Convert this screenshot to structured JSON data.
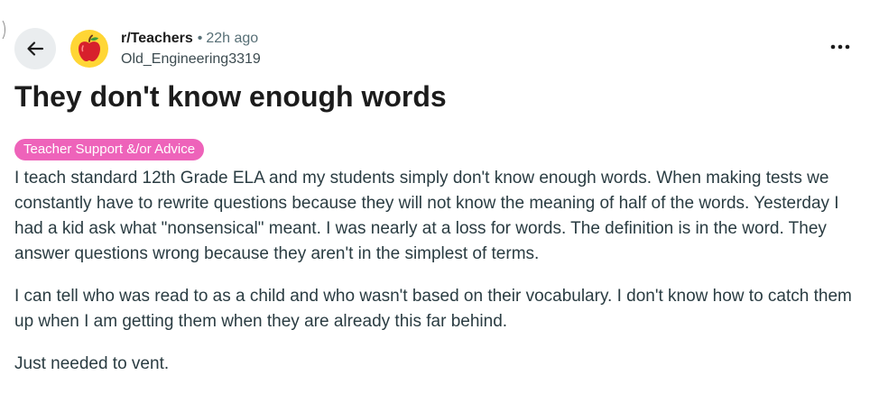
{
  "header": {
    "back_icon": "arrow-left-icon",
    "avatar_icon": "apple-icon",
    "subreddit": "r/Teachers",
    "separator": "•",
    "time": "22h ago",
    "author": "Old_Engineering3319",
    "more_icon": "more-horizontal-icon"
  },
  "post": {
    "title": "They don't know enough words",
    "flair": "Teacher Support &/or Advice",
    "paragraphs": [
      "I teach standard 12th Grade ELA and my students simply don't know enough words. When making tests we constantly have to rewrite questions because they will not know the meaning of half of the words. Yesterday I had a kid ask what \"nonsensical\" meant. I was nearly at a loss for words. The definition is in the word. They answer questions wrong because they aren't in the simplest of terms.",
      "I can tell who was read to as a child and who wasn't based on their vocabulary. I don't know how to catch them up when I am getting them when they are already this far behind.",
      "Just needed to vent."
    ]
  },
  "colors": {
    "flair_background": "#ee63ba",
    "avatar_background": "#ffd635",
    "back_button_background": "#eaedef",
    "muted_text": "#576f76"
  }
}
